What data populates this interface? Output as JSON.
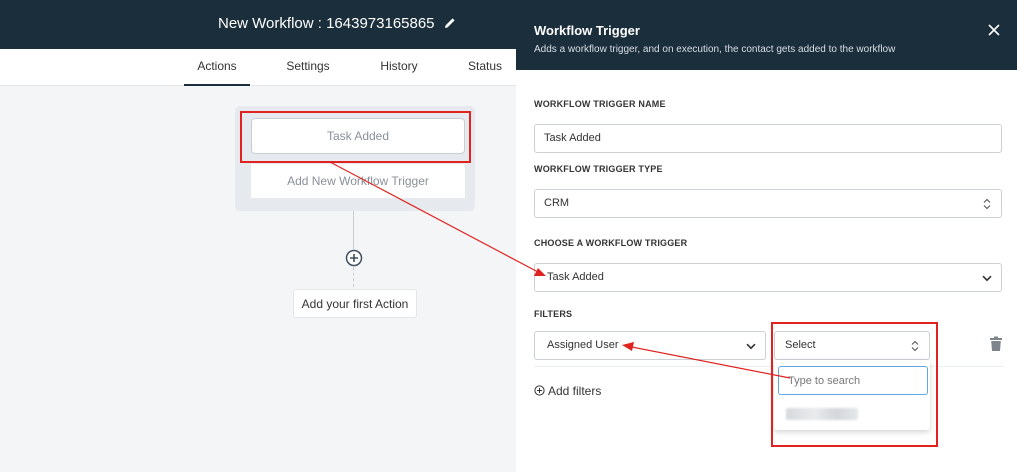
{
  "workflow": {
    "title": "New Workflow : 1643973165865",
    "tabs": [
      {
        "label": "Actions",
        "active": true
      },
      {
        "label": "Settings",
        "active": false
      },
      {
        "label": "History",
        "active": false
      },
      {
        "label": "Status",
        "active": false
      }
    ],
    "trigger_card": "Task Added",
    "add_trigger": "Add New Workflow Trigger",
    "first_action": "Add your first Action"
  },
  "panel": {
    "title": "Workflow Trigger",
    "subtitle": "Adds a workflow trigger, and on execution, the contact gets added to the workflow",
    "name_label": "WORKFLOW TRIGGER NAME",
    "name_value": "Task Added",
    "type_label": "WORKFLOW TRIGGER TYPE",
    "type_value": "CRM",
    "choose_label": "CHOOSE A WORKFLOW TRIGGER",
    "choose_value": "Task Added",
    "filters_label": "FILTERS",
    "filter_field": "Assigned User",
    "filter_value": "Select",
    "search_placeholder": "Type to search",
    "add_filters": "Add filters"
  },
  "colors": {
    "header": "#1b2e3c",
    "highlight": "#e0231f",
    "focus": "#5ea8e8"
  }
}
